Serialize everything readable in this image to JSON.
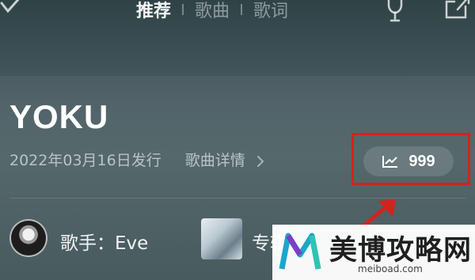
{
  "tabs": [
    {
      "label": "推荐",
      "active": true
    },
    {
      "label": "歌曲",
      "active": false
    },
    {
      "label": "歌词",
      "active": false
    }
  ],
  "song": {
    "title": "YOKU",
    "release": "2022年03月16日发行",
    "detail_link": "歌曲详情",
    "rank_value": "999"
  },
  "artist": {
    "label": "歌手：Eve"
  },
  "album": {
    "label": "专辑"
  },
  "watermark": {
    "text": "美博攻略网",
    "url": "meiboad.com"
  },
  "icons": {
    "top_left": "check-icon",
    "top_right_1": "trophy-icon",
    "top_right_2": "share-icon",
    "rank": "trend-icon",
    "detail": "chevron-right-icon"
  },
  "colors": {
    "highlight_box": "#d2231f",
    "background": "#4a5d62"
  }
}
